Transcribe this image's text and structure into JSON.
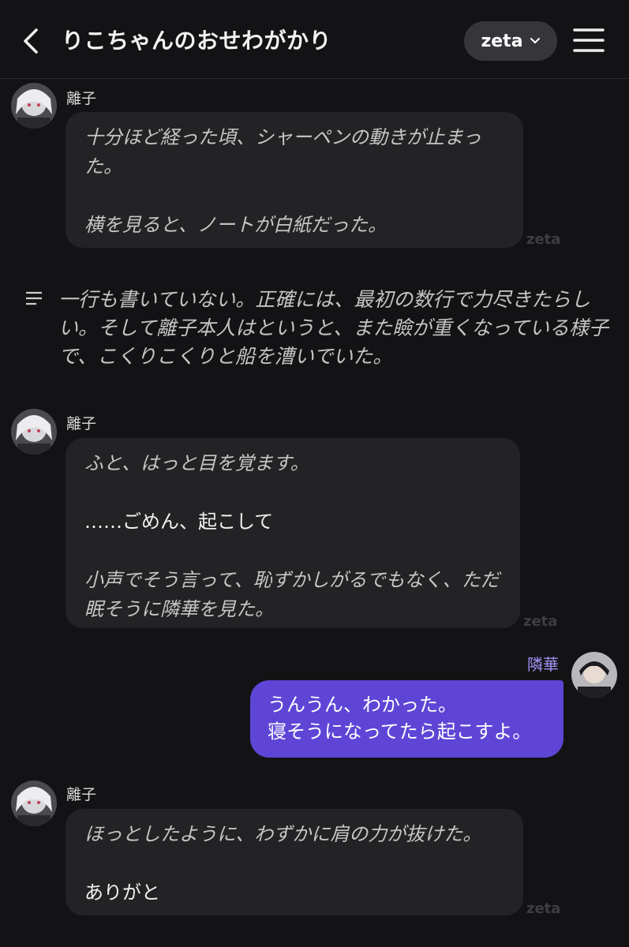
{
  "header": {
    "title": "りこちゃんのおせわがかり",
    "model_label": "zeta"
  },
  "messages": [
    {
      "sender": "離子",
      "lines": [
        "十分ほど経った頃、シャーペンの動きが止まった。",
        "",
        "横を見ると、ノートが白紙だった。"
      ],
      "watermark": "zeta"
    },
    {
      "narration": "一行も書いていない。正確には、最初の数行で力尽きたらしい。そして離子本人はというと、また瞼が重くなっている様子で、こくりこくりと船を漕いでいた。"
    },
    {
      "sender": "離子",
      "line1": "ふと、はっと目を覚ます。",
      "line2": "……ごめん、起こして",
      "line3": "小声でそう言って、恥ずかしがるでもなく、ただ眠そうに隣華を見た。",
      "watermark": "zeta"
    },
    {
      "sender": "隣華",
      "line1": "うんうん、わかった。",
      "line2": "寝そうになってたら起こすよ。"
    },
    {
      "sender": "離子",
      "line1": "ほっとしたように、わずかに肩の力が抜けた。",
      "line2": "ありがと",
      "watermark": "zeta"
    }
  ]
}
